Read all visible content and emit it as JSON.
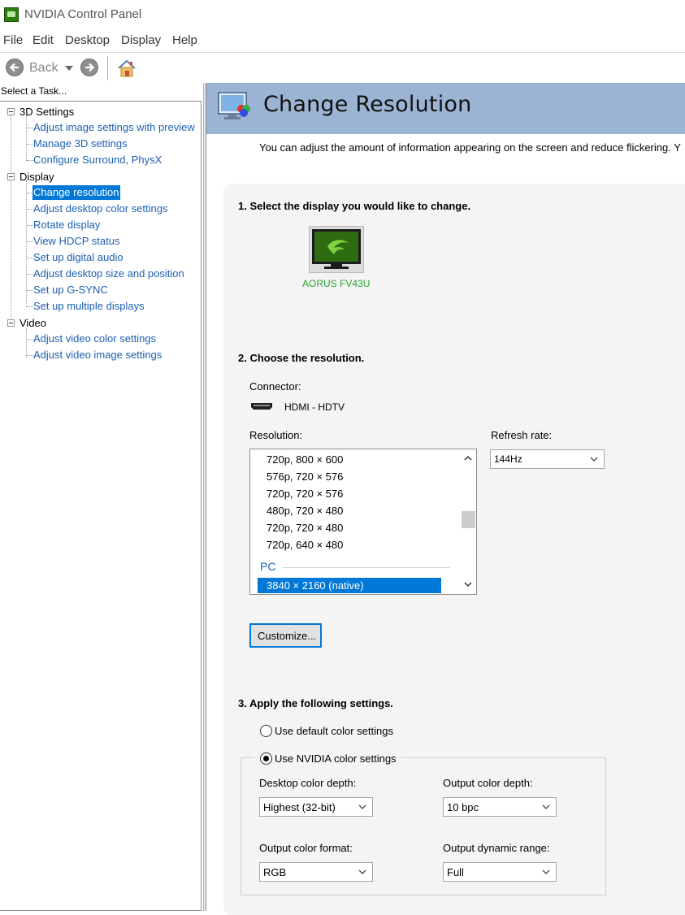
{
  "window": {
    "title": "NVIDIA Control Panel"
  },
  "menu": [
    "File",
    "Edit",
    "Desktop",
    "Display",
    "Help"
  ],
  "toolbar": {
    "back_label": "Back"
  },
  "task_panel": {
    "header": "Select a Task...",
    "categories": [
      {
        "label": "3D Settings",
        "items": [
          "Adjust image settings with preview",
          "Manage 3D settings",
          "Configure Surround, PhysX"
        ]
      },
      {
        "label": "Display",
        "items": [
          "Change resolution",
          "Adjust desktop color settings",
          "Rotate display",
          "View HDCP status",
          "Set up digital audio",
          "Adjust desktop size and position",
          "Set up G-SYNC",
          "Set up multiple displays"
        ]
      },
      {
        "label": "Video",
        "items": [
          "Adjust video color settings",
          "Adjust video image settings"
        ]
      }
    ],
    "selected_item": "Change resolution"
  },
  "page": {
    "title": "Change Resolution",
    "intro": "You can adjust the amount of information appearing on the screen and reduce flickering. Y",
    "step1": {
      "heading": "1. Select the display you would like to change.",
      "display_name": "AORUS FV43U"
    },
    "step2": {
      "heading": "2. Choose the resolution.",
      "connector_label": "Connector:",
      "connector_value": "HDMI - HDTV",
      "resolution_label": "Resolution:",
      "resolutions": [
        "720p, 800 × 600",
        "576p, 720 × 576",
        "720p, 720 × 576",
        "480p, 720 × 480",
        "720p, 720 × 480",
        "720p, 640 × 480"
      ],
      "group_label": "PC",
      "selected_resolution": "3840 × 2160 (native)",
      "refresh_label": "Refresh rate:",
      "refresh_value": "144Hz",
      "customize_label": "Customize..."
    },
    "step3": {
      "heading": "3. Apply the following settings.",
      "radio_default": "Use default color settings",
      "radio_nvidia": "Use NVIDIA color settings",
      "selected_radio": "nvidia",
      "desktop_depth_label": "Desktop color depth:",
      "desktop_depth_value": "Highest (32-bit)",
      "output_depth_label": "Output color depth:",
      "output_depth_value": "10 bpc",
      "output_format_label": "Output color format:",
      "output_format_value": "RGB",
      "output_range_label": "Output dynamic range:",
      "output_range_value": "Full"
    }
  },
  "colors": {
    "accent": "#0078d7",
    "link": "#1d5fb3",
    "header_band": "#9cb4d4",
    "display_name": "#27a52b"
  }
}
